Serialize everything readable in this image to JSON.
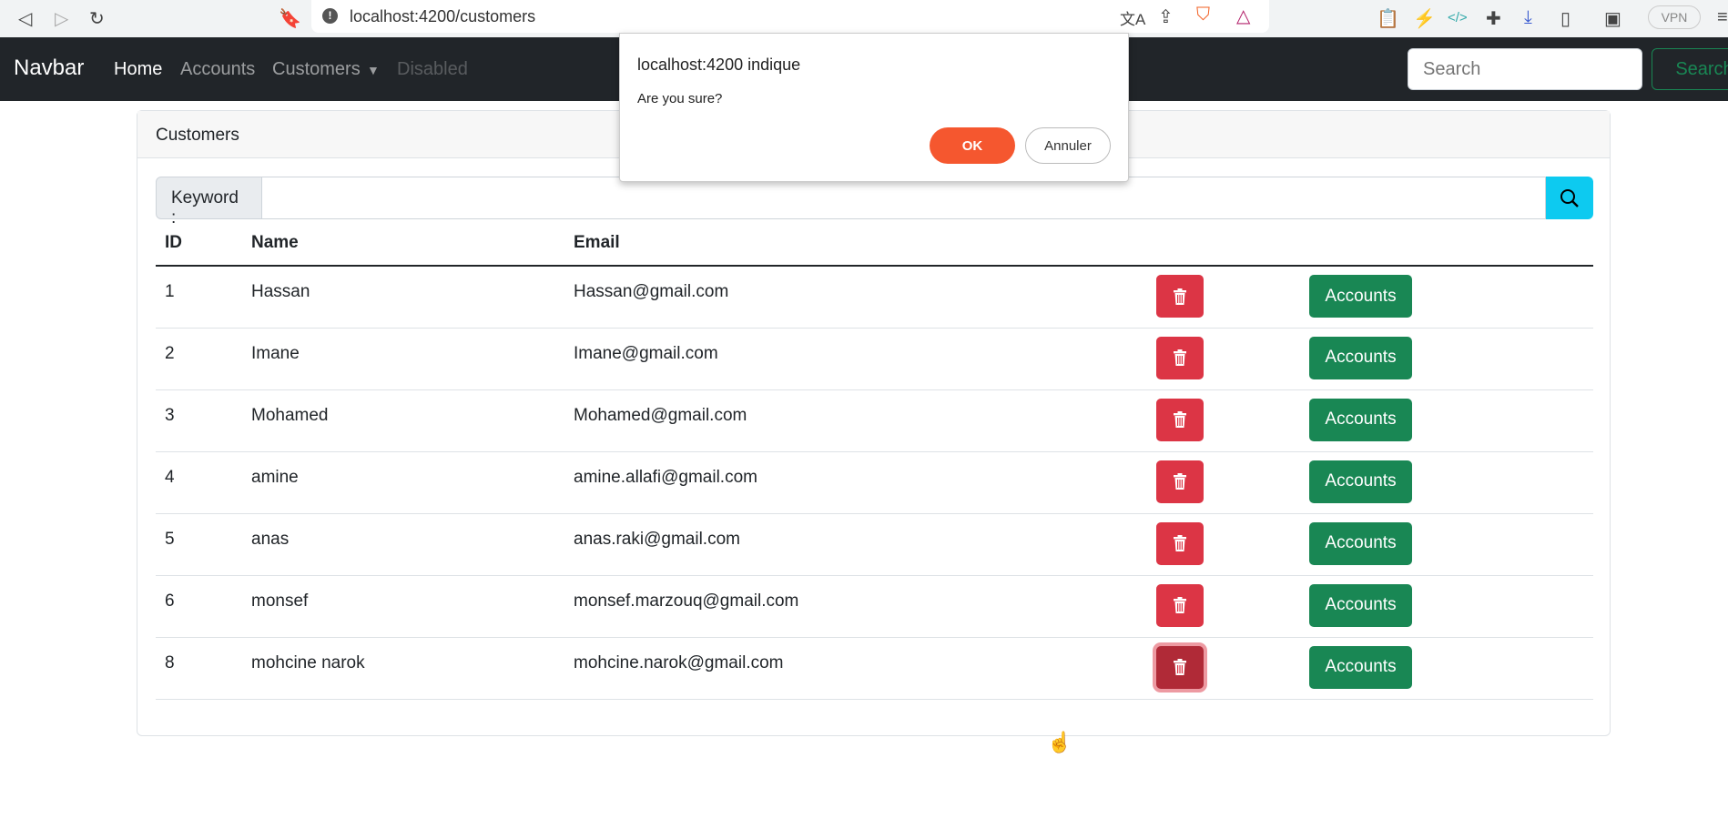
{
  "browser": {
    "url": "localhost:4200/customers",
    "vpn_label": "VPN"
  },
  "navbar": {
    "brand": "Navbar",
    "links": [
      "Home",
      "Accounts",
      "Customers",
      "Disabled"
    ],
    "search_placeholder": "Search",
    "search_button": "Search"
  },
  "card": {
    "title": "Customers",
    "keyword_label": "Keyword :",
    "keyword_value": ""
  },
  "table": {
    "headers": [
      "ID",
      "Name",
      "Email"
    ],
    "rows": [
      {
        "id": "1",
        "name": "Hassan",
        "email": "Hassan@gmail.com"
      },
      {
        "id": "2",
        "name": "Imane",
        "email": "Imane@gmail.com"
      },
      {
        "id": "3",
        "name": "Mohamed",
        "email": "Mohamed@gmail.com"
      },
      {
        "id": "4",
        "name": "amine",
        "email": "amine.allafi@gmail.com"
      },
      {
        "id": "5",
        "name": "anas",
        "email": "anas.raki@gmail.com"
      },
      {
        "id": "6",
        "name": "monsef",
        "email": "monsef.marzouq@gmail.com"
      },
      {
        "id": "8",
        "name": "mohcine narok",
        "email": "mohcine.narok@gmail.com"
      }
    ],
    "accounts_label": "Accounts"
  },
  "dialog": {
    "title": "localhost:4200 indique",
    "message": "Are you sure?",
    "ok": "OK",
    "cancel": "Annuler"
  },
  "colors": {
    "navbar": "#212529",
    "danger": "#dc3545",
    "success": "#198754",
    "info": "#0dcaf0",
    "dialog_ok": "#f5572f"
  }
}
